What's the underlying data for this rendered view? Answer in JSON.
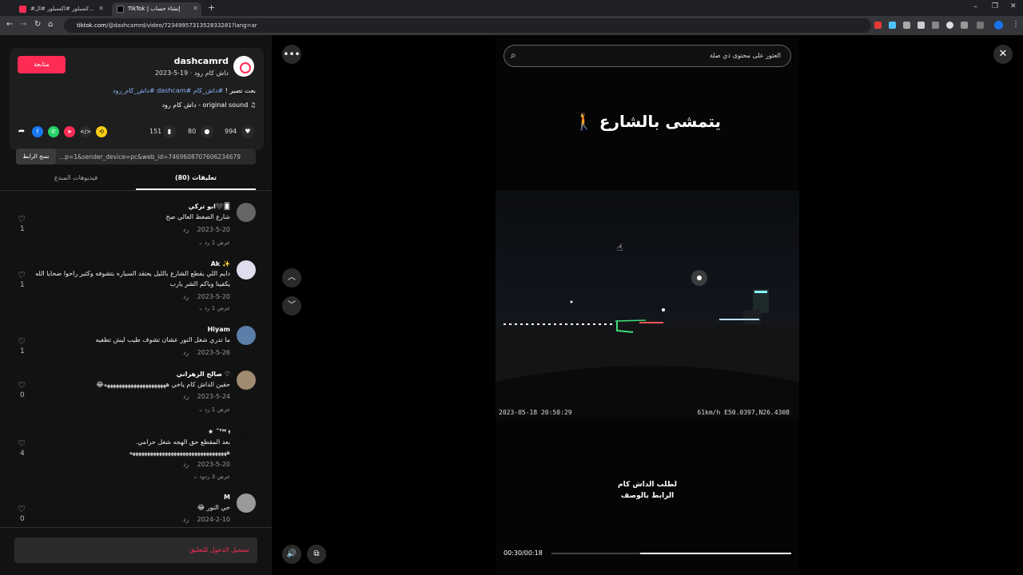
{
  "browser": {
    "tabs": [
      {
        "label": "#كسبلور #اكسبلور #ال...",
        "active": false
      },
      {
        "label": "#اكسبلور #كسبلور #ال...",
        "active": false
      },
      {
        "label": "TikTok | إنشاء حساب",
        "active": true
      }
    ],
    "new_tab": "+",
    "url_host": "tiktok.com",
    "url_path": "/@dashcamrd/video/7234995731352833281?lang=ar"
  },
  "post": {
    "follow_label": "متابعة",
    "username": "dashcamrd",
    "subline": "داش كام رود · 19-5-2023",
    "desc_prefix": "بعت تصير ! ",
    "desc_tags": "#داش_كام #dashcam #داش_كام_رود",
    "sound": "original sound - داش كام رود",
    "likes": "994",
    "comments": "80",
    "saves": "151",
    "copy_label": "نسخ الرابط",
    "link_text": "...p=1&sender_device=pc&web_id=7469608707606234679"
  },
  "tabs": {
    "comments_label": "(80) تعليقات",
    "creator_videos_label": "فيديوهات المبدع"
  },
  "comments": [
    {
      "name": "ابو تركي🖤🂠",
      "text": "شارع الضغط العالي صح",
      "date": "2023-5-20",
      "reply": "رد",
      "more": "عرض 1 رد ⌄",
      "likes": "1"
    },
    {
      "name": "Ak ✨",
      "text": "دايم اللي يقطع الشارع بالليل يعتقد السياره بتشوفه وكثير راحوا ضحايا الله",
      "text2": "يكفينا وياكم الشر يارب",
      "date": "2023-5-20",
      "reply": "رد",
      "more": "عرض 1 رد ⌄",
      "likes": "1"
    },
    {
      "name": "Hiyam",
      "text": "ما تدري شغل النور عشان تشوف طيب ليش تطفيه",
      "date": "2023-5-26",
      "reply": "رد",
      "likes": "1"
    },
    {
      "name": "صالح الزهراني ♡",
      "text": "حقين الداش كام ياخي هههههههههههههههههههههه😂",
      "date": "2023-5-24",
      "reply": "رد",
      "more": "عرض 1 رد ⌄",
      "likes": "0"
    },
    {
      "name": "★ ˝°ᴹ ᵼ",
      "text": "بعد المقطع حق الهجه شغل حرامي.",
      "text2": "هههههههههههههههههههههههههههههههههه",
      "date": "2023-5-20",
      "reply": "رد",
      "more": "عرض 3 ردود ⌄",
      "likes": "4"
    },
    {
      "name": "M",
      "text": "حي النور 😂",
      "date": "2024-2-10",
      "reply": "رد",
      "likes": "0"
    }
  ],
  "login_prompt": "تسجيل الدخول للتعليق",
  "video": {
    "search_placeholder": "العثور على محتوى ذي صلة",
    "caption": "يتمشى بالشارع 🚶",
    "stamp_left": "2023-05-18 20:50:29",
    "stamp_right": "61km/h E50.0397,N26.4308",
    "order_line1": "لطلب الداش كام",
    "order_line2": "الرابط بالوصف",
    "time": "00:30/00:18",
    "progress": 0.63
  },
  "colors": {
    "accent": "#fe2c55",
    "link": "#8ab4f8"
  }
}
